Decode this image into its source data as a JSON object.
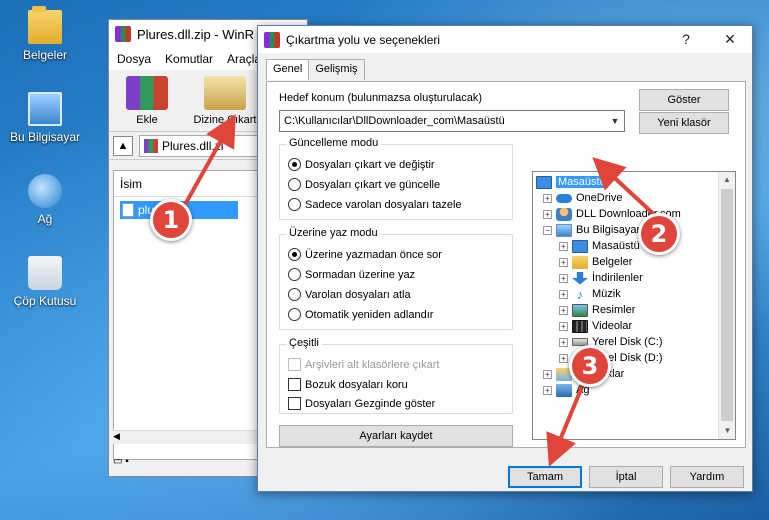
{
  "desktop": {
    "icons": [
      {
        "label": "Belgeler",
        "icon": "documents-folder-icon"
      },
      {
        "label": "Bu Bilgisayar",
        "icon": "this-pc-icon"
      },
      {
        "label": "Ağ",
        "icon": "network-icon"
      },
      {
        "label": "Çöp Kutusu",
        "icon": "recycle-bin-icon"
      }
    ]
  },
  "winrar": {
    "title": "Plures.dll.zip - WinR",
    "menu": [
      "Dosya",
      "Komutlar",
      "Araçla"
    ],
    "toolbar": {
      "add_label": "Ekle",
      "extract_label": "Dizine Çıkart"
    },
    "address": "Plures.dll.zi",
    "list_header": "İsim",
    "file_name": "plures.dll"
  },
  "dialog": {
    "title": "Çıkartma yolu ve seçenekleri",
    "help_glyph": "?",
    "close_glyph": "✕",
    "tabs": [
      "Genel",
      "Gelişmiş"
    ],
    "destination_label": "Hedef konum (bulunmazsa oluşturulacak)",
    "destination_value": "C:\\Kullanıcılar\\DllDownloader_com\\Masaüstü",
    "show_button": "Göster",
    "new_folder_button": "Yeni klasör",
    "update_mode": {
      "title": "Güncelleme modu",
      "options": [
        "Dosyaları çıkart ve değiştir",
        "Dosyaları çıkart ve güncelle",
        "Sadece varolan dosyaları tazele"
      ],
      "selected": 0
    },
    "overwrite_mode": {
      "title": "Üzerine yaz modu",
      "options": [
        "Üzerine yazmadan önce sor",
        "Sormadan üzerine yaz",
        "Varolan dosyaları atla",
        "Otomatik yeniden adlandır"
      ],
      "selected": 0
    },
    "misc": {
      "title": "Çeşitli",
      "options": [
        "Arşivleri alt klasörlere çıkart",
        "Bozuk dosyaları koru",
        "Dosyaları Gezginde göster"
      ]
    },
    "save_settings_button": "Ayarları kaydet",
    "tree": [
      "Masaüstü",
      "OneDrive",
      "DLL Downloader.com",
      "Bu Bilgisayar",
      "Masaüstü",
      "Belgeler",
      "İndirilenler",
      "Müzik",
      "Resimler",
      "Videolar",
      "Yerel Disk (C:)",
      "Yerel Disk (D:)",
      "Kitaplıklar",
      "Ağ"
    ],
    "ok_button": "Tamam",
    "cancel_button": "İptal",
    "help_button": "Yardım"
  },
  "annotations": {
    "step1": "1",
    "step2": "2",
    "step3": "3",
    "color": "#e0453b"
  }
}
